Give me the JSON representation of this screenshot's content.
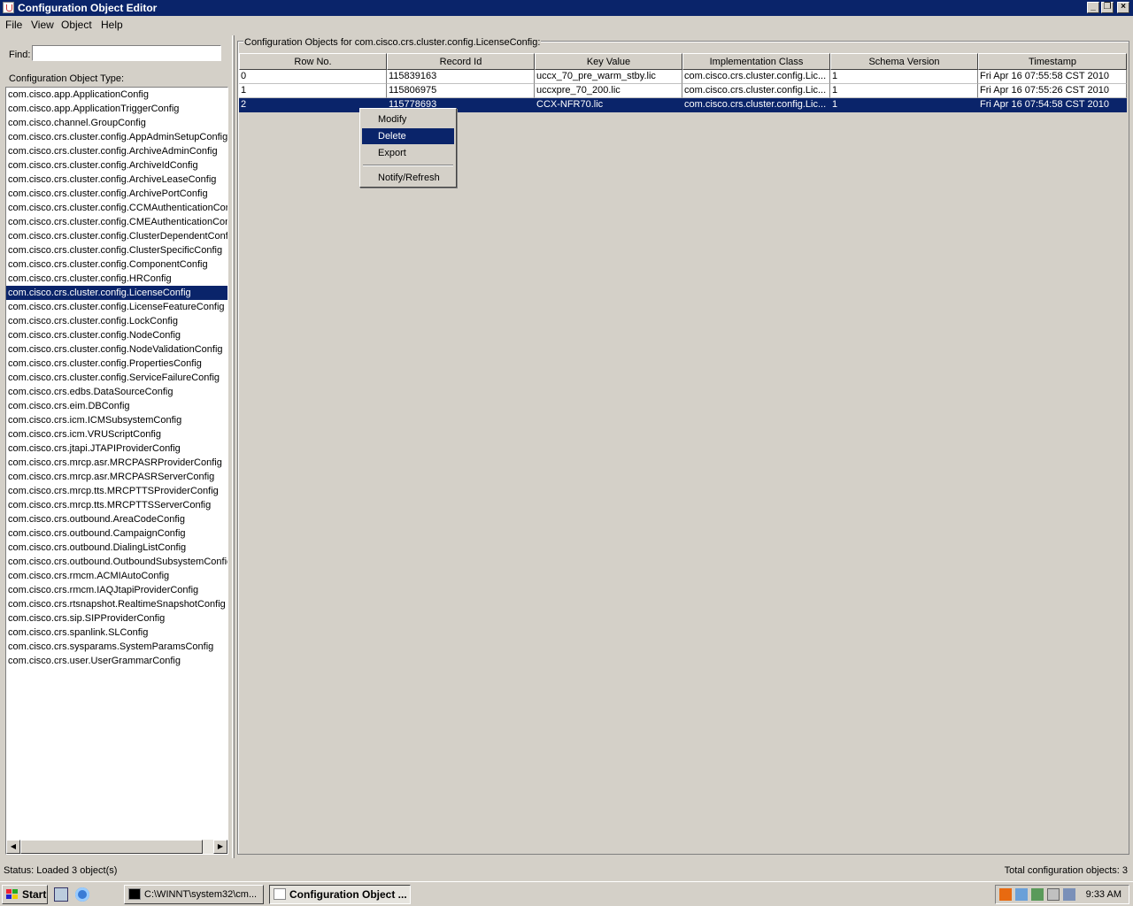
{
  "window": {
    "title": "Configuration Object Editor"
  },
  "menu": [
    "File",
    "View",
    "Object",
    "Help"
  ],
  "left": {
    "find_label": "Find:",
    "find_value": "",
    "type_label": "Configuration Object Type:",
    "selected_index": 14,
    "types": [
      "com.cisco.app.ApplicationConfig",
      "com.cisco.app.ApplicationTriggerConfig",
      "com.cisco.channel.GroupConfig",
      "com.cisco.crs.cluster.config.AppAdminSetupConfig",
      "com.cisco.crs.cluster.config.ArchiveAdminConfig",
      "com.cisco.crs.cluster.config.ArchiveIdConfig",
      "com.cisco.crs.cluster.config.ArchiveLeaseConfig",
      "com.cisco.crs.cluster.config.ArchivePortConfig",
      "com.cisco.crs.cluster.config.CCMAuthenticationCor",
      "com.cisco.crs.cluster.config.CMEAuthenticationCon",
      "com.cisco.crs.cluster.config.ClusterDependentConf",
      "com.cisco.crs.cluster.config.ClusterSpecificConfig",
      "com.cisco.crs.cluster.config.ComponentConfig",
      "com.cisco.crs.cluster.config.HRConfig",
      "com.cisco.crs.cluster.config.LicenseConfig",
      "com.cisco.crs.cluster.config.LicenseFeatureConfig",
      "com.cisco.crs.cluster.config.LockConfig",
      "com.cisco.crs.cluster.config.NodeConfig",
      "com.cisco.crs.cluster.config.NodeValidationConfig",
      "com.cisco.crs.cluster.config.PropertiesConfig",
      "com.cisco.crs.cluster.config.ServiceFailureConfig",
      "com.cisco.crs.edbs.DataSourceConfig",
      "com.cisco.crs.eim.DBConfig",
      "com.cisco.crs.icm.ICMSubsystemConfig",
      "com.cisco.crs.icm.VRUScriptConfig",
      "com.cisco.crs.jtapi.JTAPIProviderConfig",
      "com.cisco.crs.mrcp.asr.MRCPASRProviderConfig",
      "com.cisco.crs.mrcp.asr.MRCPASRServerConfig",
      "com.cisco.crs.mrcp.tts.MRCPTTSProviderConfig",
      "com.cisco.crs.mrcp.tts.MRCPTTSServerConfig",
      "com.cisco.crs.outbound.AreaCodeConfig",
      "com.cisco.crs.outbound.CampaignConfig",
      "com.cisco.crs.outbound.DialingListConfig",
      "com.cisco.crs.outbound.OutboundSubsystemConfic",
      "com.cisco.crs.rmcm.ACMIAutoConfig",
      "com.cisco.crs.rmcm.IAQJtapiProviderConfig",
      "com.cisco.crs.rtsnapshot.RealtimeSnapshotConfig",
      "com.cisco.crs.sip.SIPProviderConfig",
      "com.cisco.crs.spanlink.SLConfig",
      "com.cisco.crs.sysparams.SystemParamsConfig",
      "com.cisco.crs.user.UserGrammarConfig"
    ]
  },
  "right": {
    "group_title": "Configuration Objects for com.cisco.crs.cluster.config.LicenseConfig:",
    "columns": [
      "Row No.",
      "Record Id",
      "Key Value",
      "Implementation Class",
      "Schema Version",
      "Timestamp"
    ],
    "selected_row": 2,
    "rows": [
      [
        "0",
        "115839163",
        "uccx_70_pre_warm_stby.lic",
        "com.cisco.crs.cluster.config.Lic...",
        "1",
        "Fri Apr 16 07:55:58 CST 2010"
      ],
      [
        "1",
        "115806975",
        "uccxpre_70_200.lic",
        "com.cisco.crs.cluster.config.Lic...",
        "1",
        "Fri Apr 16 07:55:26 CST 2010"
      ],
      [
        "2",
        "115778693",
        "CCX-NFR70.lic",
        "com.cisco.crs.cluster.config.Lic...",
        "1",
        "Fri Apr 16 07:54:58 CST 2010"
      ]
    ]
  },
  "context_menu": {
    "items": [
      "Modify",
      "Delete",
      "Export"
    ],
    "after_separator": "Notify/Refresh",
    "highlighted": "Delete"
  },
  "status": {
    "left": "Status: Loaded 3 object(s)",
    "right": "Total configuration objects: 3"
  },
  "taskbar": {
    "start": "Start",
    "tasks": [
      "C:\\WINNT\\system32\\cm...",
      "Configuration Object ..."
    ],
    "active_task": 1,
    "clock": "9:33 AM"
  },
  "colors": {
    "selection": "#0a246a",
    "face": "#d4d0c8"
  }
}
